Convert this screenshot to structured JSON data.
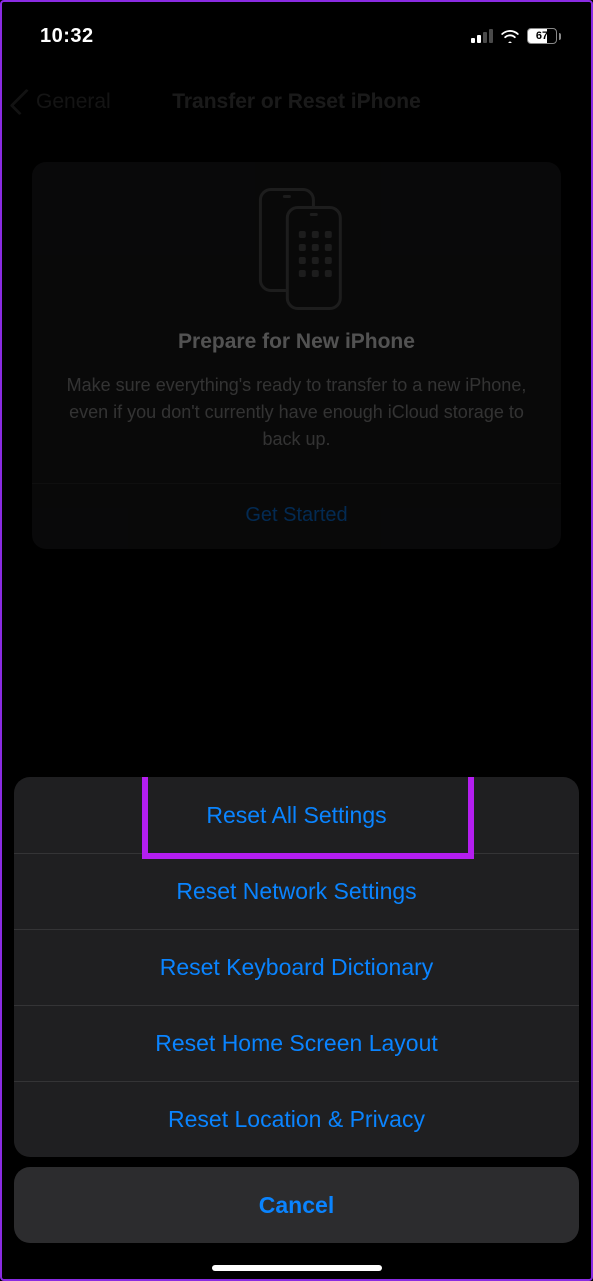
{
  "status": {
    "time": "10:32",
    "battery_pct": "67"
  },
  "nav": {
    "back_label": "General",
    "title": "Transfer or Reset iPhone"
  },
  "card": {
    "title": "Prepare for New iPhone",
    "desc": "Make sure everything's ready to transfer to a new iPhone, even if you don't currently have enough iCloud storage to back up.",
    "action": "Get Started"
  },
  "sheet": {
    "options": [
      "Reset All Settings",
      "Reset Network Settings",
      "Reset Keyboard Dictionary",
      "Reset Home Screen Layout",
      "Reset Location & Privacy"
    ],
    "cancel": "Cancel",
    "highlighted_index": 0
  }
}
